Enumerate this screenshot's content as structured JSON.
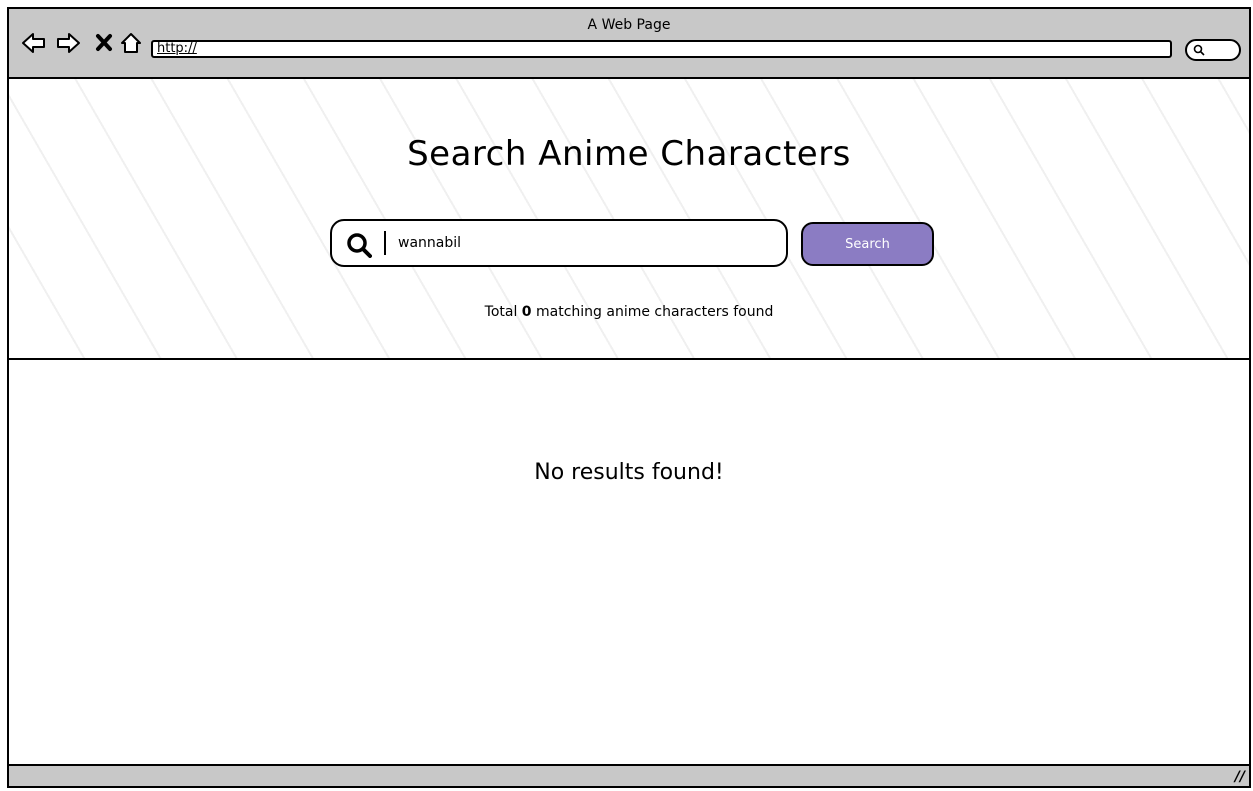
{
  "window": {
    "title": "A Web Page"
  },
  "browser": {
    "url": "http://",
    "nav_icons": [
      "back-arrow-icon",
      "forward-arrow-icon",
      "close-icon",
      "home-icon"
    ],
    "search_icon": "search-icon"
  },
  "hero": {
    "title": "Search Anime Characters",
    "search": {
      "value": "wannabil",
      "icon": "search-icon"
    },
    "search_button_label": "Search",
    "result_count": {
      "prefix": "Total",
      "count": "0",
      "suffix": "matching anime characters found"
    }
  },
  "content": {
    "empty_message": "No results found!"
  },
  "colors": {
    "accent": "#8b7cc3",
    "chrome": "#c8c8c8"
  }
}
